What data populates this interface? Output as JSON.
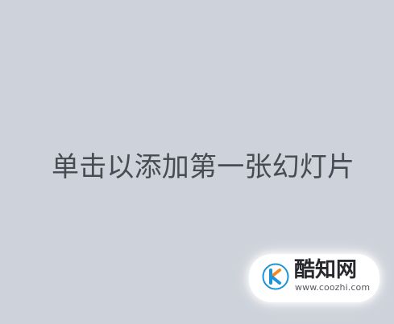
{
  "slide": {
    "placeholder_text": "单击以添加第一张幻灯片"
  },
  "watermark": {
    "brand": "酷知网",
    "url": "www.coozhi.com"
  },
  "colors": {
    "canvas_bg": "#ced2da",
    "placeholder_text": "#474b52",
    "watermark_blue": "#1b94d8",
    "watermark_orange": "#f28b1f"
  }
}
